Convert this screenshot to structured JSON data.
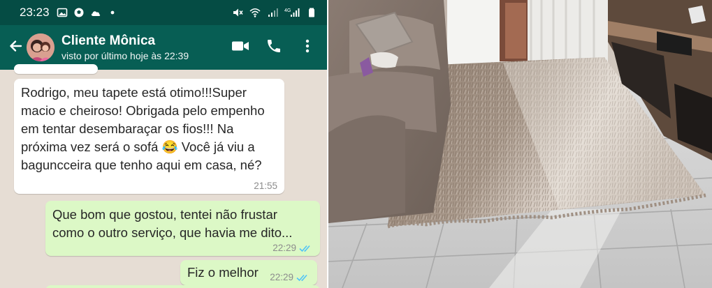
{
  "status_bar": {
    "time": "23:23",
    "left_icons": [
      "image-icon",
      "soccer-ball-icon",
      "cloud-icon",
      "dot-icon"
    ],
    "right_icons": [
      "mute-icon",
      "wifi-icon",
      "signal-icon",
      "signal-4g-icon",
      "battery-icon"
    ],
    "network_label": "4G"
  },
  "header": {
    "contact_name": "Cliente Mônica",
    "last_seen": "visto por último hoje às 22:39",
    "icons": [
      "back-arrow-icon",
      "video-call-icon",
      "phone-icon",
      "more-vert-icon"
    ]
  },
  "messages": [
    {
      "direction": "in",
      "text": "Rodrigo, meu tapete está otimo!!!Super\nmacio e cheiroso! Obrigada pelo empenho\nem tentar desembaraçar os fios!!! Na\npróxima vez será o sofá 😂 Você já viu a\nbaguncceira que tenho aqui em casa, né?",
      "time": "21:55"
    },
    {
      "direction": "out",
      "text": "Que bom que gostou, tentei não frustar\ncomo o outro serviço, que havia me dito...",
      "time": "22:29",
      "read": true
    },
    {
      "direction": "out",
      "text": "Fiz o melhor",
      "time": "22:29",
      "read": true
    }
  ],
  "colors": {
    "status_bar": "#054c44",
    "app_bar": "#075e54",
    "chat_bg": "#e6ddd4",
    "bubble_in": "#ffffff",
    "bubble_out": "#dcf8c6",
    "read_ticks": "#4fc3f7"
  }
}
